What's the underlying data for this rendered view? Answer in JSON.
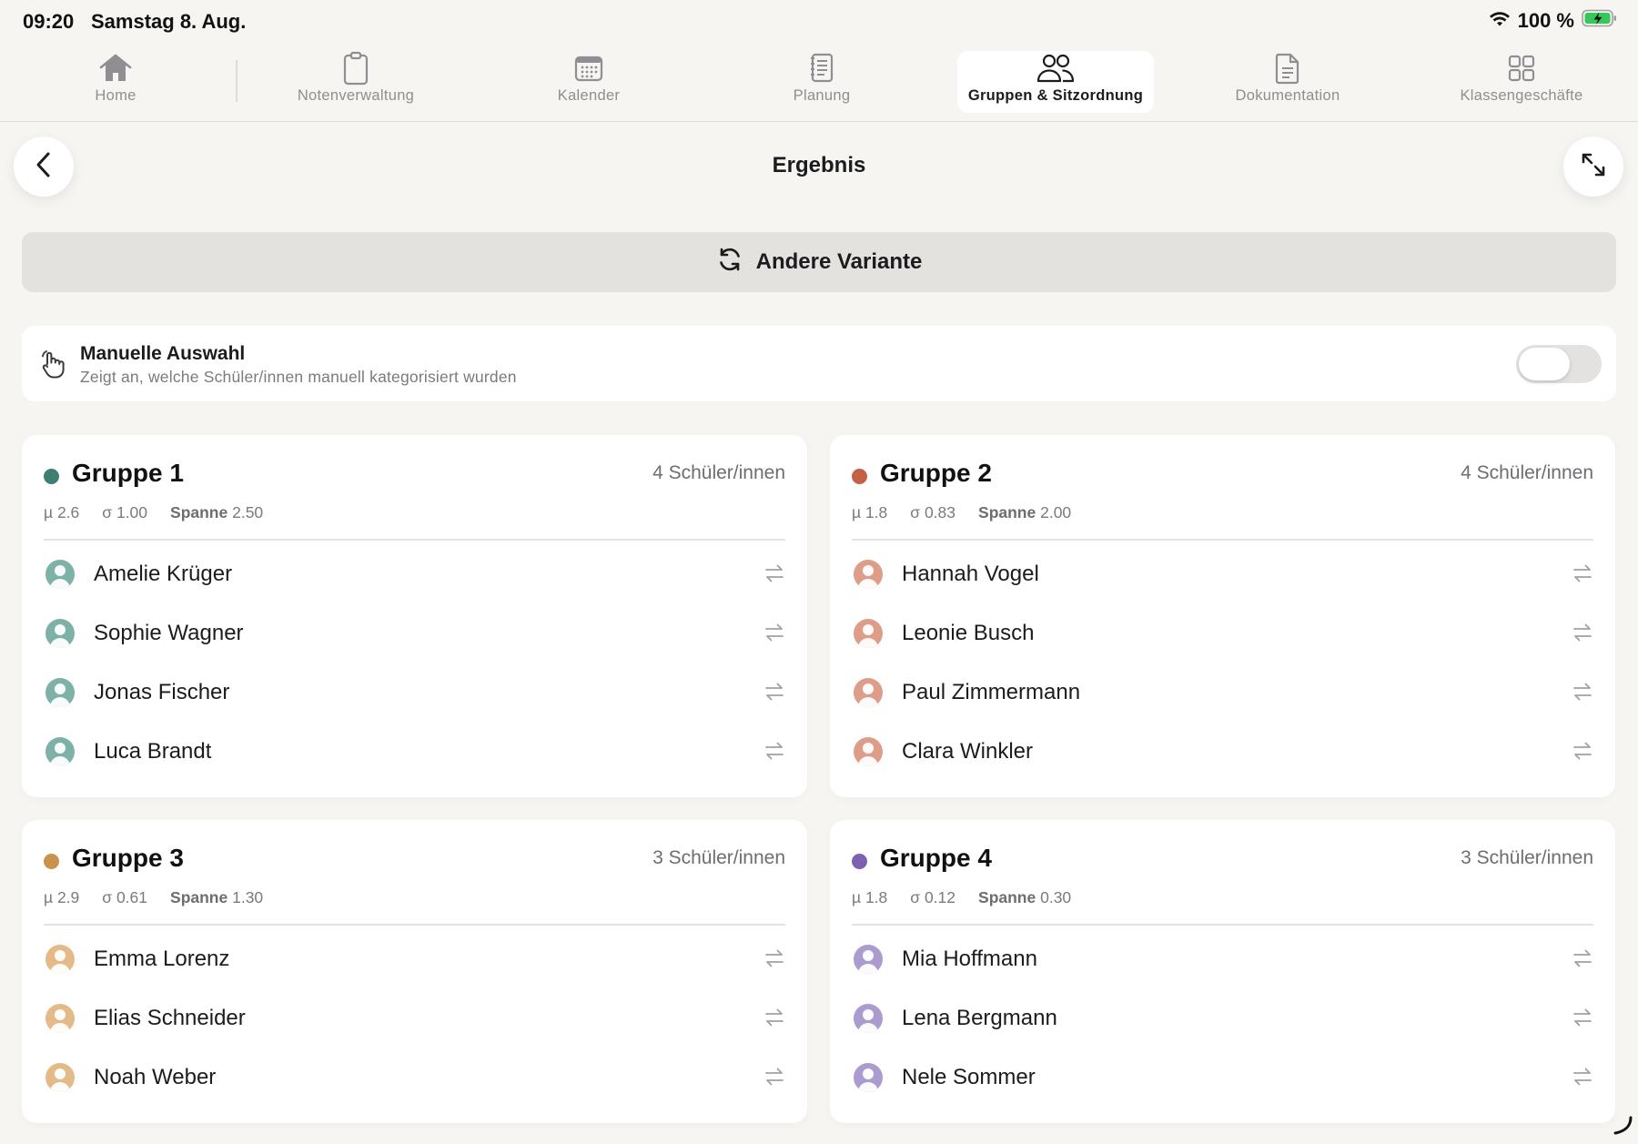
{
  "status_bar": {
    "time": "09:20",
    "date": "Samstag 8. Aug.",
    "battery": "100 %"
  },
  "tabs": [
    {
      "label": "Home",
      "icon": "house-icon"
    },
    {
      "label": "Notenverwaltung",
      "icon": "clipboard-icon"
    },
    {
      "label": "Kalender",
      "icon": "calendar-icon"
    },
    {
      "label": "Planung",
      "icon": "notebook-icon"
    },
    {
      "label": "Gruppen & Sitzordnung",
      "icon": "people-icon",
      "active": true
    },
    {
      "label": "Dokumentation",
      "icon": "document-icon"
    },
    {
      "label": "Klassengeschäfte",
      "icon": "grid-icon"
    }
  ],
  "header": {
    "title": "Ergebnis"
  },
  "variant_button": {
    "label": "Andere Variante"
  },
  "manual_selection": {
    "title": "Manuelle Auswahl",
    "subtitle": "Zeigt an, welche Schüler/innen manuell kategorisiert wurden",
    "enabled": false
  },
  "groups": [
    {
      "name": "Gruppe 1",
      "count": "4 Schüler/innen",
      "color": "#3f7f73",
      "avatar_color": "#7eb1a7",
      "mean": "µ 2.6",
      "sd": "σ 1.00",
      "range_label": "Spanne",
      "range_value": "2.50",
      "members": [
        "Amelie Krüger",
        "Sophie Wagner",
        "Jonas Fischer",
        "Luca Brandt"
      ]
    },
    {
      "name": "Gruppe 2",
      "count": "4 Schüler/innen",
      "color": "#c45f48",
      "avatar_color": "#dd9d88",
      "mean": "µ 1.8",
      "sd": "σ 0.83",
      "range_label": "Spanne",
      "range_value": "2.00",
      "members": [
        "Hannah Vogel",
        "Leonie Busch",
        "Paul Zimmermann",
        "Clara Winkler"
      ]
    },
    {
      "name": "Gruppe 3",
      "count": "3 Schüler/innen",
      "color": "#c8934a",
      "avatar_color": "#e3ba88",
      "mean": "µ 2.9",
      "sd": "σ 0.61",
      "range_label": "Spanne",
      "range_value": "1.30",
      "members": [
        "Emma Lorenz",
        "Elias Schneider",
        "Noah Weber"
      ]
    },
    {
      "name": "Gruppe 4",
      "count": "3 Schüler/innen",
      "color": "#7b62b0",
      "avatar_color": "#ab9bcf",
      "mean": "µ 1.8",
      "sd": "σ 0.12",
      "range_label": "Spanne",
      "range_value": "0.30",
      "members": [
        "Mia Hoffmann",
        "Lena Bergmann",
        "Nele Sommer"
      ]
    }
  ]
}
